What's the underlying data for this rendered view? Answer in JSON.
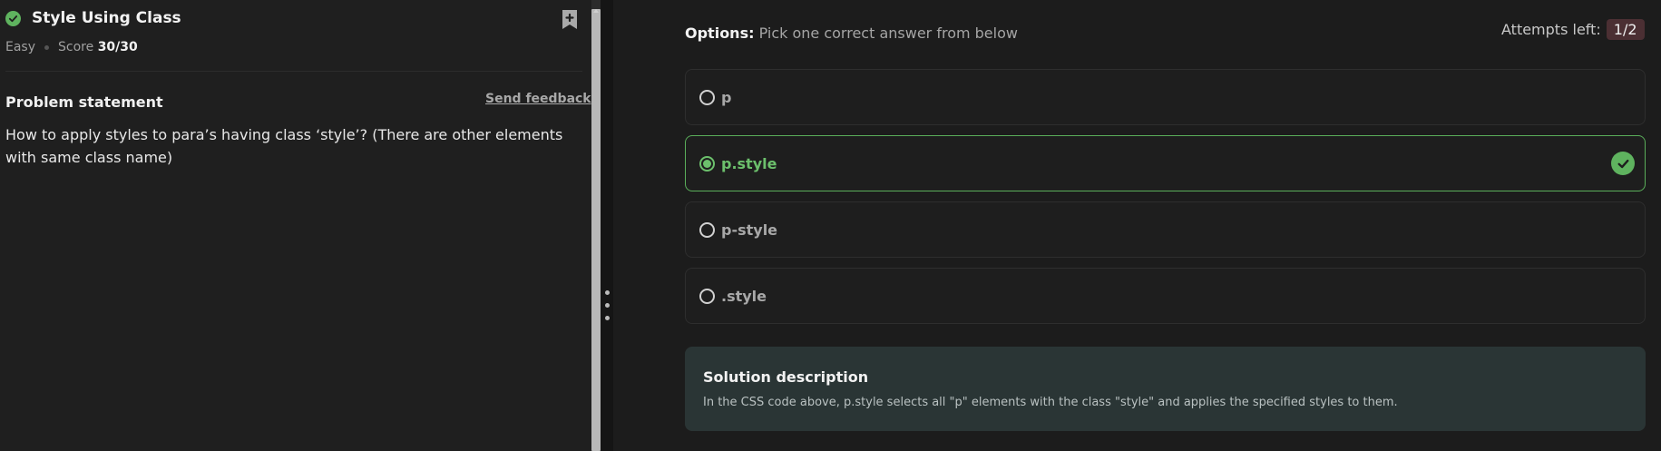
{
  "problem": {
    "title": "Style Using Class",
    "difficulty": "Easy",
    "score_label": "Score",
    "score_value": "30/30",
    "statement_heading": "Problem statement",
    "feedback_link": "Send feedback",
    "statement_text": "How to apply styles to para’s having class ‘style’? (There are other elements with same class name)"
  },
  "quiz": {
    "options_label": "Options:",
    "options_hint": "Pick one correct answer from below",
    "attempts_label": "Attempts left:",
    "attempts_value": "1/2",
    "options": [
      {
        "label": "p",
        "selected": false
      },
      {
        "label": "p.style",
        "selected": true,
        "correct": true
      },
      {
        "label": "p-style",
        "selected": false
      },
      {
        "label": ".style",
        "selected": false
      }
    ]
  },
  "solution": {
    "title": "Solution description",
    "text": "In the CSS code above, p.style selects all \"p\" elements with the class \"style\" and applies the specified styles to them."
  },
  "colors": {
    "success": "#5fb35f",
    "attempts_badge": "#4b2f33",
    "solution_bg": "#2a3535"
  },
  "icons": {
    "status": "check-circle-icon",
    "bookmark": "bookmark-plus-icon",
    "correct": "check-circle-icon",
    "splitter": "drag-handle-icon"
  }
}
